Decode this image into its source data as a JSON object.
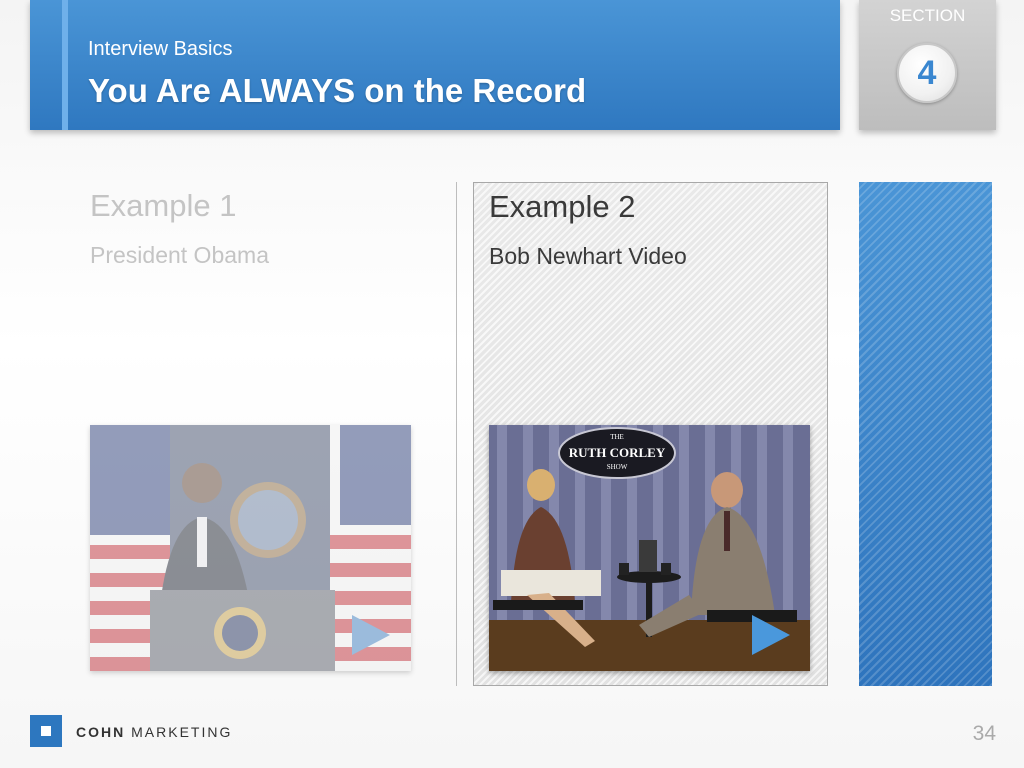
{
  "header": {
    "subtitle": "Interview Basics",
    "title": "You Are ALWAYS on the Record",
    "accent_color": "#2f78c0"
  },
  "section": {
    "label": "SECTION",
    "number": "4"
  },
  "examples": [
    {
      "title": "Example 1",
      "subtitle": "President Obama",
      "thumbnail_icon": "podium-speech-video-thumbnail",
      "active": false
    },
    {
      "title": "Example 2",
      "subtitle": "Bob Newhart Video",
      "thumbnail_icon": "talk-show-video-thumbnail",
      "thumbnail_sign": [
        "THE",
        "RUTH CORLEY",
        "SHOW"
      ],
      "active": true
    }
  ],
  "footer": {
    "brand_bold": "COHN",
    "brand_light": "MARKETING",
    "page_number": "34"
  }
}
